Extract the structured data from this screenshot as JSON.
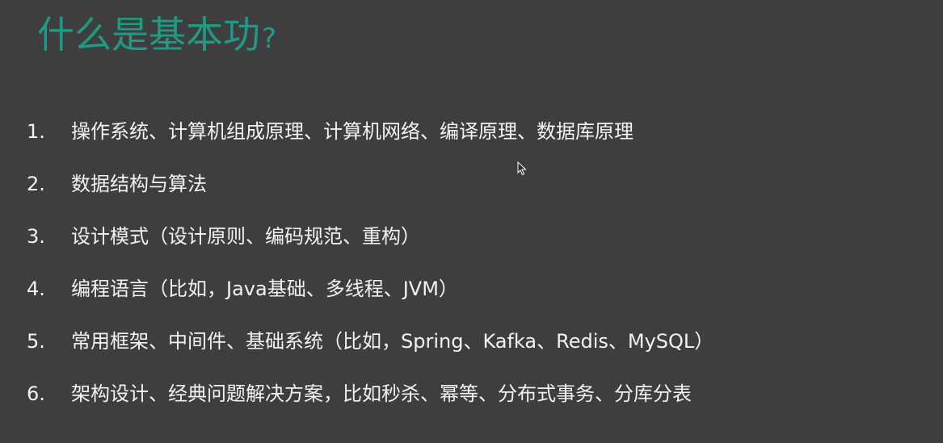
{
  "slide": {
    "title": "什么是基本功",
    "title_mark": "?",
    "title_color": "#1f9b85",
    "background": "#3e3e3e",
    "items": [
      {
        "number": "1.",
        "text": "操作系统、计算机组成原理、计算机网络、编译原理、数据库原理"
      },
      {
        "number": "2.",
        "text": "数据结构与算法"
      },
      {
        "number": "3.",
        "text": "设计模式（设计原则、编码规范、重构）"
      },
      {
        "number": "4.",
        "text": "编程语言（比如，Java基础、多线程、JVM）"
      },
      {
        "number": "5.",
        "text": "常用框架、中间件、基础系统（比如，Spring、Kafka、Redis、MySQL）"
      },
      {
        "number": "6.",
        "text": "架构设计、经典问题解决方案，比如秒杀、幂等、分布式事务、分库分表"
      }
    ]
  },
  "cursor": {
    "icon": "mouse-pointer-icon"
  }
}
